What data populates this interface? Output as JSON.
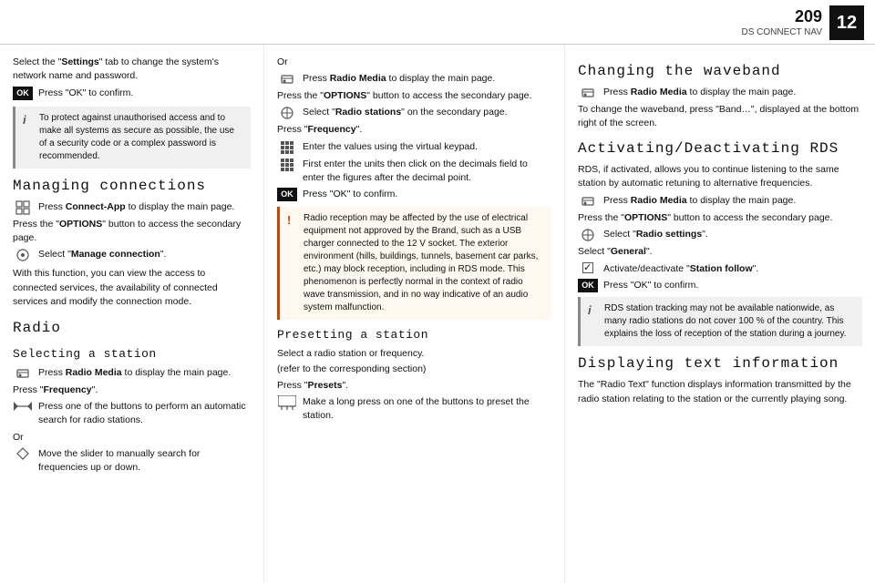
{
  "header": {
    "page_number": "209",
    "chapter_title": "DS CONNECT NAV",
    "chapter_number": "12"
  },
  "col_left": {
    "intro_text": "Select the \"Settings\" tab to change the system's network name and password.",
    "ok_press": "Press \"OK\" to confirm.",
    "info_box": "To protect against unauthorised access and to make all systems as secure as possible, the use of a security code or a complex password is recommended.",
    "section_managing": "Managing connections",
    "connect_app_step": "Press Connect-App to display the main page.",
    "options_step": "Press the \"OPTIONS\" button to access the secondary page.",
    "manage_connection_step": "Select \"Manage connection\".",
    "description": "With this function, you can view the access to connected services, the availability of connected services and modify the connection mode.",
    "section_radio": "Radio",
    "sub_selecting": "Selecting a station",
    "radio_media_step": "Press Radio Media to display the main page.",
    "frequency_step": "Press \"Frequency\".",
    "search_step": "Press one of the buttons to perform an automatic search for radio stations.",
    "or1": "Or",
    "slider_step": "Move the slider to manually search for frequencies up or down."
  },
  "col_middle": {
    "or_top": "Or",
    "press_radio_media": "Press Radio Media to display the main page.",
    "press_options": "Press the \"OPTIONS\" button to access the secondary page.",
    "select_radio_stations": "Select \"Radio stations\" on the secondary page.",
    "press_frequency": "Press \"Frequency\".",
    "enter_values": "Enter the values using the virtual keypad.",
    "first_enter": "First enter the units then click on the decimals field to enter the figures after the decimal point.",
    "ok_press": "Press \"OK\" to confirm.",
    "warning_box": "Radio reception may be affected by the use of electrical equipment not approved by the Brand, such as a USB charger connected to the 12 V socket. The exterior environment (hills, buildings, tunnels, basement car parks, etc.) may block reception, including in RDS mode. This phenomenon is perfectly normal in the context of radio wave transmission, and in no way indicative of an audio system malfunction.",
    "sub_presetting": "Presetting a station",
    "select_station": "Select a radio station or frequency.",
    "refer": "(refer to the corresponding section)",
    "press_presets": "Press \"Presets\".",
    "make_long_press": "Make a long press on one of the buttons to preset the station."
  },
  "col_right": {
    "section_waveband": "Changing the waveband",
    "radio_media_step": "Press Radio Media to display the main page.",
    "waveband_desc": "To change the waveband, press \"Band…\", displayed at the bottom right of the screen.",
    "section_rds": "Activating/Deactivating RDS",
    "rds_desc": "RDS, if activated, allows you to continue listening to the same station by automatic retuning to alternative frequencies.",
    "rds_radio_step": "Press Radio Media to display the main page.",
    "rds_options_step": "Press the \"OPTIONS\" button to access the secondary page.",
    "rds_select_settings": "Select \"Radio settings\".",
    "select_general": "Select \"General\".",
    "activate_station": "Activate/deactivate \"Station follow\".",
    "ok_press": "Press \"OK\" to confirm.",
    "info_box": "RDS station tracking may not be available nationwide, as many radio stations do not cover 100 % of the country. This explains the loss of reception of the station during a journey.",
    "section_displaying": "Displaying text information",
    "displaying_desc": "The \"Radio Text\" function displays information transmitted by the radio station relating to the station or the currently playing song."
  }
}
